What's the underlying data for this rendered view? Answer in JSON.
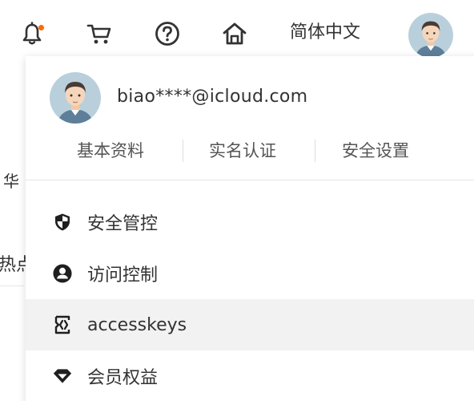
{
  "topbar": {
    "icons": [
      "bell-icon",
      "cart-icon",
      "help-icon",
      "home-icon"
    ],
    "language": "简体中文",
    "notification_dot_color": "#ff6a00"
  },
  "background": {
    "fragment_1": "华",
    "fragment_2": "热点"
  },
  "account_menu": {
    "email": "biao****@icloud.com",
    "links": [
      "基本资料",
      "实名认证",
      "安全设置"
    ],
    "items": [
      {
        "label": "安全管控",
        "icon": "shield-icon"
      },
      {
        "label": "访问控制",
        "icon": "user-circle-icon"
      },
      {
        "label": "accesskeys",
        "icon": "key-brackets-icon",
        "highlighted": true
      },
      {
        "label": "会员权益",
        "icon": "diamond-icon"
      }
    ]
  }
}
